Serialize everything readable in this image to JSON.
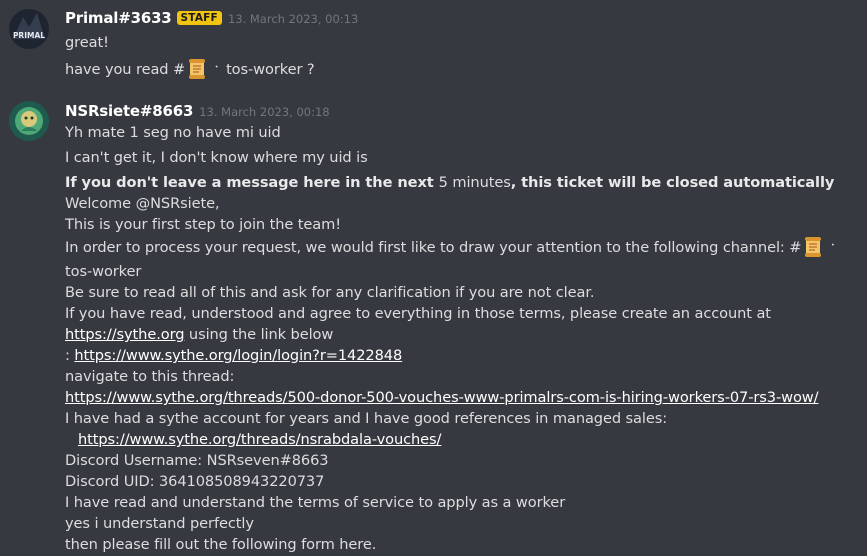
{
  "messages": [
    {
      "username": "Primal#3633",
      "badge": "STAFF",
      "timestamp": "13. March 2023, 00:13",
      "avatar_text": "PRIMAL",
      "lines": [
        "great!"
      ],
      "channel_line": {
        "prefix": "have you read ",
        "hash": "#",
        "channel": "tos-worker",
        "suffix": " ?"
      }
    },
    {
      "username": "NSRsiete#8663",
      "timestamp": "13. March 2023, 00:18",
      "lines": [
        "Yh mate 1 seg no have mi uid",
        "I can't get it, I don't know where my uid is"
      ]
    }
  ],
  "bot_message": {
    "warning_bold_1": "If you don't leave a message here in the next ",
    "warning_regular": "5 minutes",
    "warning_bold_2": ", this ticket will be closed automatically",
    "welcome": "Welcome @NSRsiete,",
    "first_step": "This is your first step to join the team!",
    "process_prefix": "In order to process your request, we would first like to draw your attention to the following channel: ",
    "hash": "#",
    "channel": "tos-worker",
    "read_all": "Be sure to read all of this and ask for any clarification if you are not clear.",
    "agree": "If you have read, understood and agree to everything in those terms, please create an account at",
    "sythe_link": "https://sythe.org",
    "using_link": " using the link below",
    "colon": ": ",
    "login_link": "https://www.sythe.org/login/login?r=1422848",
    "navigate": "navigate to this thread:",
    "thread_link": "https://www.sythe.org/threads/500-donor-500-vouches-www-primalrs-com-is-hiring-workers-07-rs3-wow/",
    "had_account": "I have had a sythe account for years and I have good references in managed sales:",
    "vouches_link": "https://www.sythe.org/threads/nsrabdala-vouches/",
    "discord_username": "Discord Username: NSRseven#8663",
    "discord_uid": "Discord UID: 364108508943220737",
    "read_terms": "I have read and understand the terms of service to apply as a worker",
    "yes": "yes i understand perfectly",
    "fill_form": "then please fill out the following form here."
  },
  "colors": {
    "background": "#36393f",
    "text": "#dcddde",
    "username": "#ffffff",
    "timestamp": "#72767d",
    "staff_badge": "#f1c40f"
  }
}
